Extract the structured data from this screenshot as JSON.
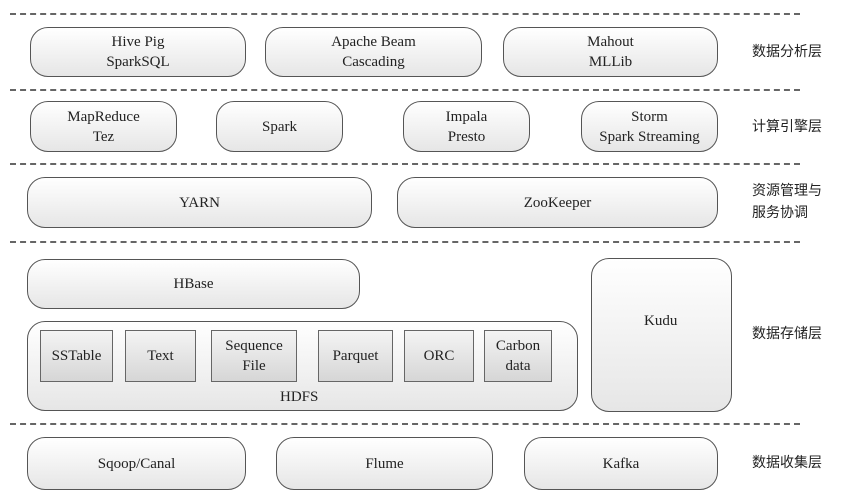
{
  "layers": [
    {
      "label": "数据分析层",
      "items": [
        "Hive Pig\nSparkSQL",
        "Apache Beam\nCascading",
        "Mahout\nMLLib"
      ]
    },
    {
      "label": "计算引擎层",
      "items": [
        "MapReduce\nTez",
        "Spark",
        "Impala\nPresto",
        "Storm\nSpark Streaming"
      ]
    },
    {
      "label": "资源管理与\n服务协调",
      "items": [
        "YARN",
        "ZooKeeper"
      ]
    },
    {
      "label": "数据存储层",
      "items": [
        "HBase",
        "HDFS",
        "Kudu"
      ],
      "formats": [
        "SSTable",
        "Text",
        "Sequence\nFile",
        "Parquet",
        "ORC",
        "Carbon\ndata"
      ]
    },
    {
      "label": "数据收集层",
      "items": [
        "Sqoop/Canal",
        "Flume",
        "Kafka"
      ]
    }
  ]
}
